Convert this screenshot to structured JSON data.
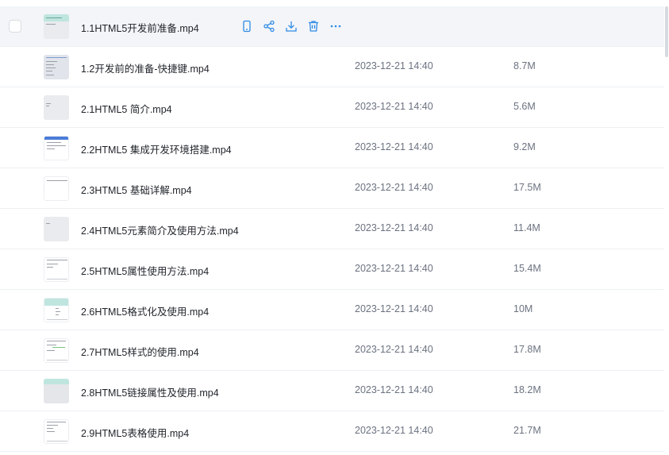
{
  "colors": {
    "accent": "#2e8ae6",
    "hover_bg": "#f3f5f8",
    "divider": "#eef0f3",
    "secondary_text": "#6b7280"
  },
  "hover_actions": {
    "icons": [
      "mobile-icon",
      "share-icon",
      "download-icon",
      "delete-icon",
      "more-icon"
    ]
  },
  "files": [
    {
      "name": "1.1HTML5开发前准备.mp4",
      "date": "",
      "size": ""
    },
    {
      "name": "1.2开发前的准备-快捷键.mp4",
      "date": "2023-12-21 14:40",
      "size": "8.7M"
    },
    {
      "name": "2.1HTML5 简介.mp4",
      "date": "2023-12-21 14:40",
      "size": "5.6M"
    },
    {
      "name": "2.2HTML5 集成开发环境搭建.mp4",
      "date": "2023-12-21 14:40",
      "size": "9.2M"
    },
    {
      "name": "2.3HTML5 基础详解.mp4",
      "date": "2023-12-21 14:40",
      "size": "17.5M"
    },
    {
      "name": "2.4HTML5元素简介及使用方法.mp4",
      "date": "2023-12-21 14:40",
      "size": "11.4M"
    },
    {
      "name": "2.5HTML5属性使用方法.mp4",
      "date": "2023-12-21 14:40",
      "size": "15.4M"
    },
    {
      "name": "2.6HTML5格式化及使用.mp4",
      "date": "2023-12-21 14:40",
      "size": "10M"
    },
    {
      "name": "2.7HTML5样式的使用.mp4",
      "date": "2023-12-21 14:40",
      "size": "17.8M"
    },
    {
      "name": "2.8HTML5链接属性及使用.mp4",
      "date": "2023-12-21 14:40",
      "size": "18.2M"
    },
    {
      "name": "2.9HTML5表格使用.mp4",
      "date": "2023-12-21 14:40",
      "size": "21.7M"
    }
  ]
}
